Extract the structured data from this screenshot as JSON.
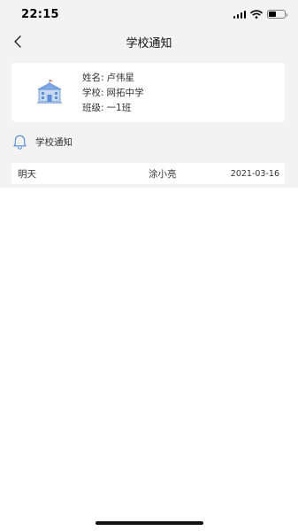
{
  "status_bar": {
    "time": "22:15",
    "icons": [
      "cellular-signal-icon",
      "wifi-icon",
      "battery-icon"
    ]
  },
  "nav": {
    "title": "学校通知",
    "back_icon": "chevron-left-icon"
  },
  "student": {
    "name_label": "姓名:",
    "name": "卢伟星",
    "school_label": "学校:",
    "school": "网拓中学",
    "class_label": "班级:",
    "class": "一1班",
    "illustration": "school-building-icon"
  },
  "section": {
    "title": "学校通知",
    "icon": "bell-icon"
  },
  "notices": [
    {
      "title": "明天",
      "sender": "涂小亮",
      "date": "2021-03-16"
    }
  ],
  "colors": {
    "page_background": "#f3f3f3",
    "card_background": "#ffffff",
    "accent_blue": "#5b8fd6"
  }
}
